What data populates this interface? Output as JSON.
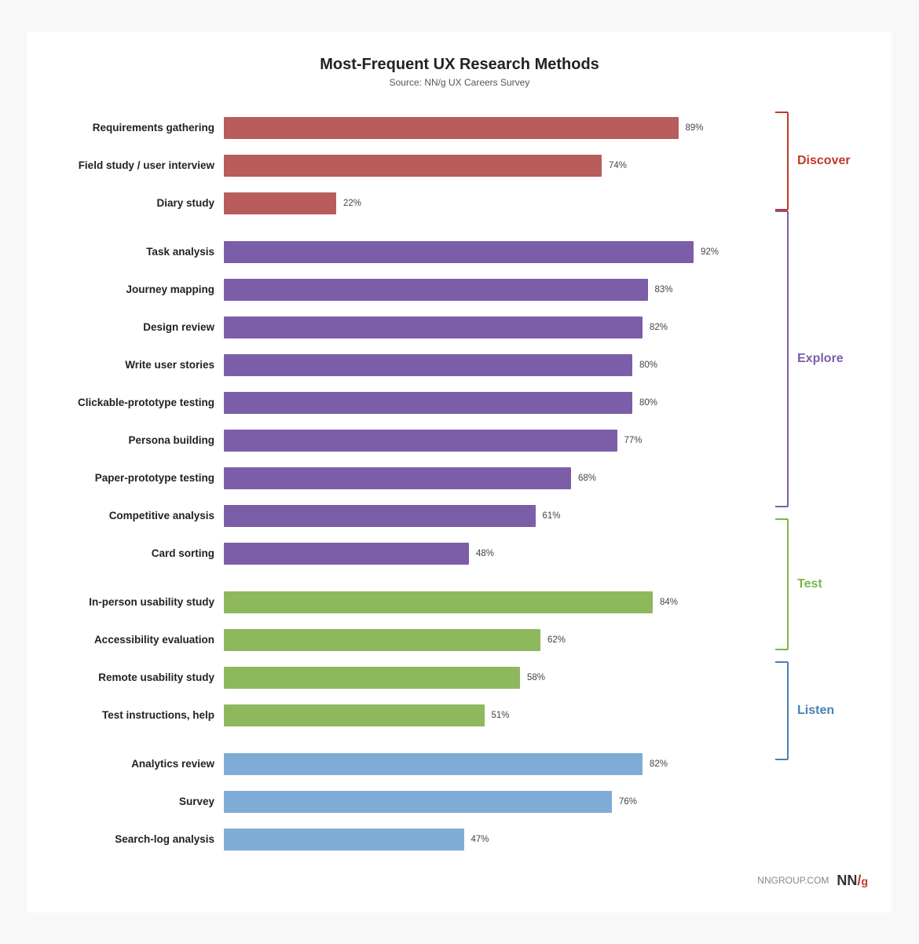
{
  "title": "Most-Frequent UX Research Methods",
  "subtitle": "Source: NN/g UX Careers Survey",
  "bars": [
    {
      "label": "Requirements gathering",
      "pct": 89,
      "color": "#b85c5c",
      "group": "discover"
    },
    {
      "label": "Field study / user interview",
      "pct": 74,
      "color": "#b85c5c",
      "group": "discover"
    },
    {
      "label": "Diary study",
      "pct": 22,
      "color": "#b85c5c",
      "group": "discover"
    },
    {
      "label": "Task analysis",
      "pct": 92,
      "color": "#7b5ea7",
      "group": "explore"
    },
    {
      "label": "Journey mapping",
      "pct": 83,
      "color": "#7b5ea7",
      "group": "explore"
    },
    {
      "label": "Design review",
      "pct": 82,
      "color": "#7b5ea7",
      "group": "explore"
    },
    {
      "label": "Write user stories",
      "pct": 80,
      "color": "#7b5ea7",
      "group": "explore"
    },
    {
      "label": "Clickable-prototype testing",
      "pct": 80,
      "color": "#7b5ea7",
      "group": "explore"
    },
    {
      "label": "Persona building",
      "pct": 77,
      "color": "#7b5ea7",
      "group": "explore"
    },
    {
      "label": "Paper-prototype testing",
      "pct": 68,
      "color": "#7b5ea7",
      "group": "explore"
    },
    {
      "label": "Competitive analysis",
      "pct": 61,
      "color": "#7b5ea7",
      "group": "explore"
    },
    {
      "label": "Card sorting",
      "pct": 48,
      "color": "#7b5ea7",
      "group": "explore"
    },
    {
      "label": "In-person usability study",
      "pct": 84,
      "color": "#8db85c",
      "group": "test"
    },
    {
      "label": "Accessibility evaluation",
      "pct": 62,
      "color": "#8db85c",
      "group": "test"
    },
    {
      "label": "Remote usability study",
      "pct": 58,
      "color": "#8db85c",
      "group": "test"
    },
    {
      "label": "Test instructions, help",
      "pct": 51,
      "color": "#8db85c",
      "group": "test"
    },
    {
      "label": "Analytics review",
      "pct": 82,
      "color": "#7facd6",
      "group": "listen"
    },
    {
      "label": "Survey",
      "pct": 76,
      "color": "#7facd6",
      "group": "listen"
    },
    {
      "label": "Search-log analysis",
      "pct": 47,
      "color": "#7facd6",
      "group": "listen"
    }
  ],
  "groups": [
    {
      "id": "discover",
      "label": "Discover",
      "color": "#c0392b",
      "startIndex": 0,
      "count": 3
    },
    {
      "id": "explore",
      "label": "Explore",
      "color": "#7b5ea7",
      "startIndex": 3,
      "count": 9
    },
    {
      "id": "test",
      "label": "Test",
      "color": "#7ab648",
      "startIndex": 12,
      "count": 4
    },
    {
      "id": "listen",
      "label": "Listen",
      "color": "#4a7fb5",
      "startIndex": 16,
      "count": 3
    }
  ],
  "maxPct": 100,
  "footer": {
    "source": "NNGROUP.COM",
    "logo_nn": "NN",
    "logo_slash": "/",
    "logo_g": "g"
  }
}
